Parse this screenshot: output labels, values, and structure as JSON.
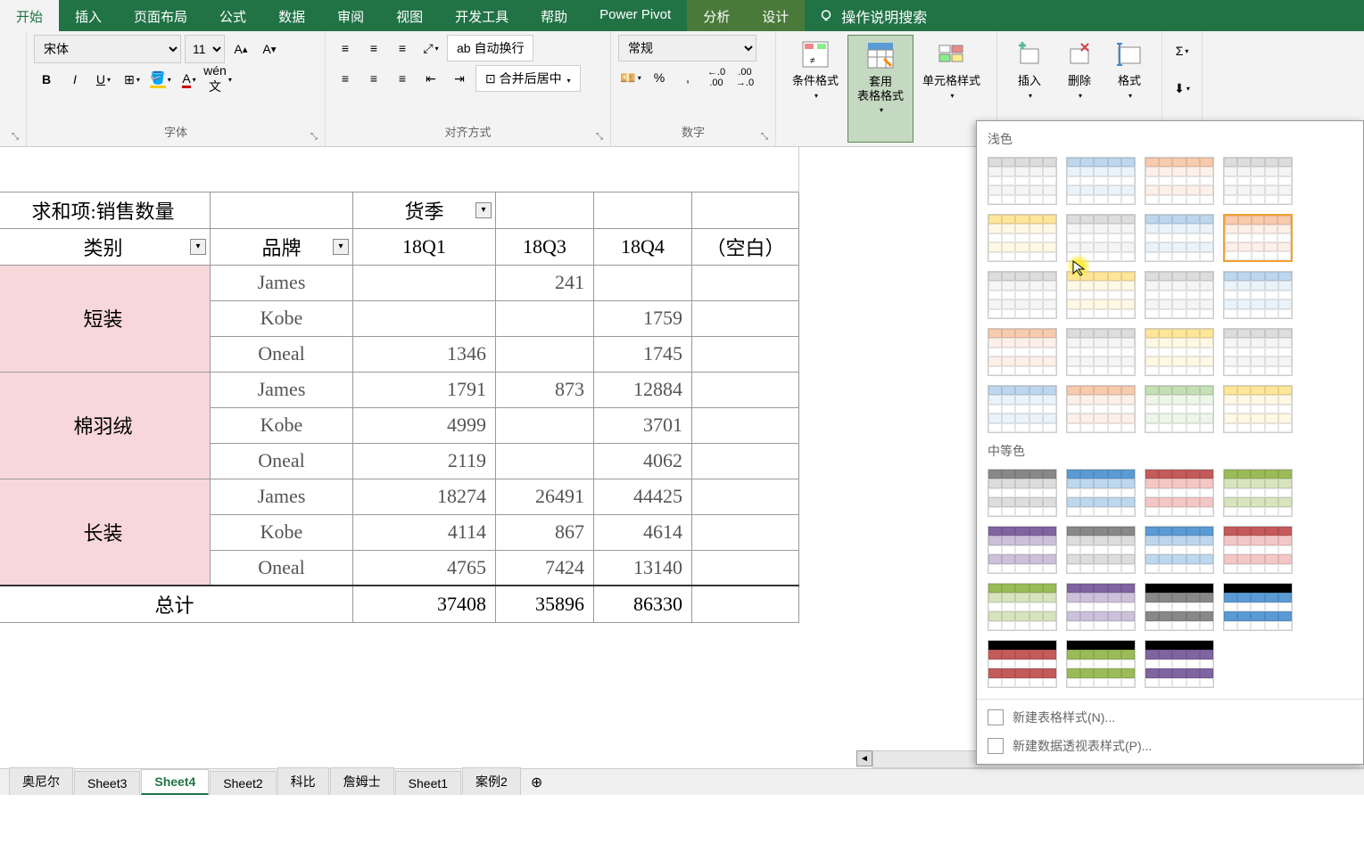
{
  "ribbon": {
    "tabs": [
      "开始",
      "插入",
      "页面布局",
      "公式",
      "数据",
      "审阅",
      "视图",
      "开发工具",
      "帮助",
      "Power Pivot",
      "分析",
      "设计"
    ],
    "activeTab": "开始",
    "searchPlaceholder": "操作说明搜索"
  },
  "font": {
    "family": "宋体",
    "size": "11",
    "groupLabel": "字体"
  },
  "alignment": {
    "wrapText": "自动换行",
    "mergeCenter": "合并后居中",
    "groupLabel": "对齐方式"
  },
  "number": {
    "format": "常规",
    "groupLabel": "数字"
  },
  "styles": {
    "conditional": "条件格式",
    "tableFormat": "套用\n表格格式",
    "cellStyles": "单元格样式"
  },
  "cells": {
    "insert": "插入",
    "delete": "删除",
    "format": "格式"
  },
  "gallery": {
    "lightLabel": "浅色",
    "mediumLabel": "中等色",
    "newTableStyle": "新建表格样式(N)...",
    "newPivotStyle": "新建数据透视表样式(P)..."
  },
  "pivot": {
    "rowHeader1": "求和项:销售数量",
    "rowHeader2": "类别",
    "colHeader1": "货季",
    "brandHeader": "品牌",
    "q1": "18Q1",
    "q3": "18Q3",
    "q4": "18Q4",
    "blank": "（空白）",
    "totalLabel": "总计",
    "categories": [
      "短装",
      "棉羽绒",
      "长装"
    ],
    "brands": [
      "James",
      "Kobe",
      "Oneal"
    ],
    "data": [
      [
        "",
        "241",
        "",
        ""
      ],
      [
        "",
        "",
        "1759",
        ""
      ],
      [
        "1346",
        "",
        "1745",
        ""
      ],
      [
        "1791",
        "873",
        "12884",
        ""
      ],
      [
        "4999",
        "",
        "3701",
        ""
      ],
      [
        "2119",
        "",
        "4062",
        ""
      ],
      [
        "18274",
        "26491",
        "44425",
        ""
      ],
      [
        "4114",
        "867",
        "4614",
        ""
      ],
      [
        "4765",
        "7424",
        "13140",
        ""
      ]
    ],
    "totals": [
      "37408",
      "35896",
      "86330",
      ""
    ]
  },
  "sheets": {
    "tabs": [
      "奥尼尔",
      "Sheet3",
      "Sheet4",
      "Sheet2",
      "科比",
      "詹姆士",
      "Sheet1",
      "案例2"
    ],
    "active": "Sheet4"
  }
}
